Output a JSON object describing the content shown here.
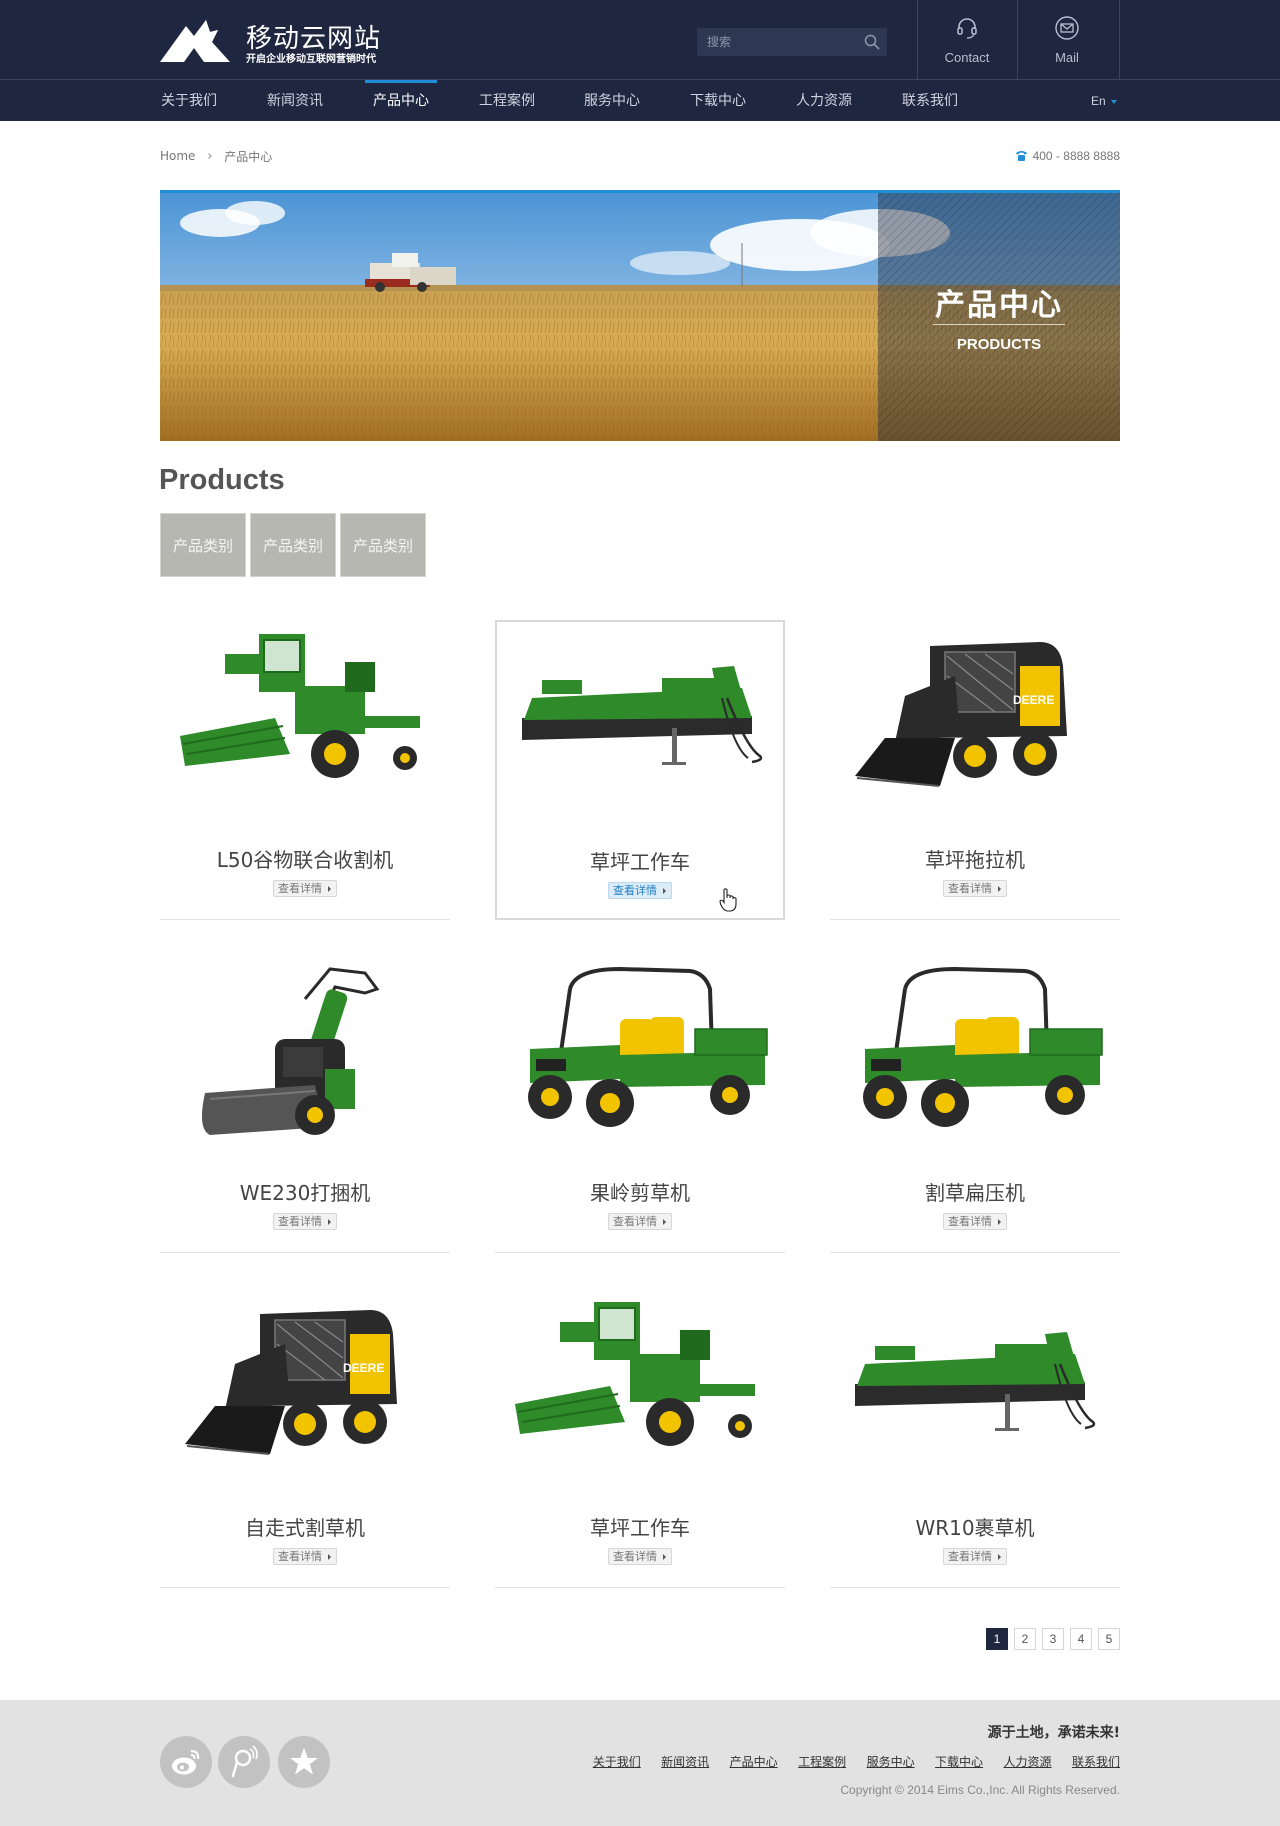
{
  "brand": {
    "title": "移动云网站",
    "subtitle": "开启企业移动互联网营销时代"
  },
  "search": {
    "placeholder": "搜索"
  },
  "header_links": {
    "contact": "Contact",
    "mail": "Mail"
  },
  "nav": {
    "items": [
      "关于我们",
      "新闻资讯",
      "产品中心",
      "工程案例",
      "服务中心",
      "下载中心",
      "人力资源",
      "联系我们"
    ],
    "active_index": 2,
    "language": "En"
  },
  "breadcrumb": {
    "home": "Home",
    "current": "产品中心"
  },
  "phone": "400 - 8888 8888",
  "banner": {
    "title_cn": "产品中心",
    "title_en": "PRODUCTS"
  },
  "products": {
    "heading": "Products",
    "categories": [
      "产品类别",
      "产品类别",
      "产品类别"
    ],
    "detail_label": "查看详情",
    "items": [
      {
        "name": "L50谷物联合收割机",
        "icon": "combine-harvester"
      },
      {
        "name": "草坪工作车",
        "icon": "mower-conditioner"
      },
      {
        "name": "草坪拖拉机",
        "icon": "skid-steer-loader"
      },
      {
        "name": "WE230打捆机",
        "icon": "walk-behind-mower"
      },
      {
        "name": "果岭剪草机",
        "icon": "utility-vehicle"
      },
      {
        "name": "割草扁压机",
        "icon": "utility-vehicle"
      },
      {
        "name": "自走式割草机",
        "icon": "skid-steer-loader"
      },
      {
        "name": "草坪工作车",
        "icon": "combine-harvester"
      },
      {
        "name": "WR10裹草机",
        "icon": "mower-conditioner"
      }
    ],
    "hovered_index": 1
  },
  "pagination": {
    "pages": [
      "1",
      "2",
      "3",
      "4",
      "5"
    ],
    "current": "1"
  },
  "footer": {
    "slogan": "源于土地，承诺未来!",
    "links": [
      "关于我们",
      "新闻资讯",
      "产品中心",
      "工程案例",
      "服务中心",
      "下载中心",
      "人力资源",
      "联系我们"
    ],
    "copyright": "Copyright © 2014  Eims Co.,Inc. All Rights Reserved.",
    "social": [
      "weibo-icon",
      "tencent-weibo-icon",
      "favorite-icon"
    ]
  },
  "colors": {
    "header_bg": "#1f2740",
    "accent": "#1e8fd6",
    "footer_bg": "#e2e2e2",
    "category_bg": "#b7b7b2",
    "tractor_green": "#2f8a2a",
    "tractor_yellow": "#f2c400"
  }
}
